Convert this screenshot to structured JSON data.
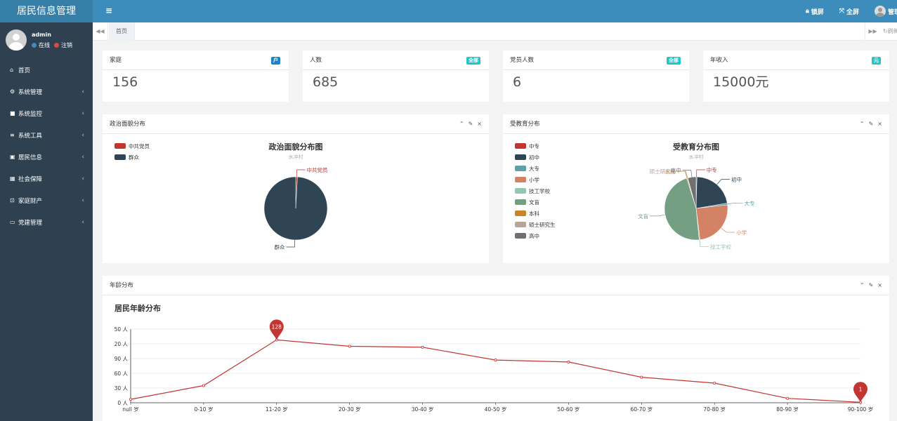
{
  "header": {
    "brand": "居民信息管理",
    "menu_toggle": "≡",
    "lock_label": "锁屏",
    "fullscreen_label": "全屏",
    "user_label": "管理员"
  },
  "sidebar": {
    "user_name": "admin",
    "online_label": "在线",
    "logout_label": "注销",
    "items": [
      {
        "label": "首页",
        "icon": "home-icon",
        "has_children": false
      },
      {
        "label": "系统管理",
        "icon": "gear-icon",
        "has_children": true
      },
      {
        "label": "系统监控",
        "icon": "video-icon",
        "has_children": true
      },
      {
        "label": "系统工具",
        "icon": "bars-icon",
        "has_children": true
      },
      {
        "label": "居民信息",
        "icon": "id-card-icon",
        "has_children": true
      },
      {
        "label": "社会保障",
        "icon": "table-icon",
        "has_children": true
      },
      {
        "label": "家庭财产",
        "icon": "box-icon",
        "has_children": true
      },
      {
        "label": "党建管理",
        "icon": "monitor-icon",
        "has_children": true
      }
    ]
  },
  "tabs": {
    "home": "首页",
    "refresh": "刷新"
  },
  "stats": [
    {
      "label": "家庭",
      "badge": "户",
      "badge_color": "#1c84c6",
      "value": "156"
    },
    {
      "label": "人数",
      "badge": "全部",
      "badge_color": "#23c6c8",
      "value": "685"
    },
    {
      "label": "党员人数",
      "badge": "全部",
      "badge_color": "#23c6c8",
      "value": "6"
    },
    {
      "label": "年收入",
      "badge": "元",
      "badge_color": "#23c6c8",
      "value": "15000元"
    }
  ],
  "panels": {
    "political": {
      "title": "政治面貌分布"
    },
    "education": {
      "title": "受教育分布"
    },
    "age": {
      "title": "年龄分布"
    },
    "tools": {
      "collapse": "⌃",
      "config": "🔧",
      "close": "×"
    }
  },
  "chart_data": [
    {
      "type": "pie",
      "title": "政治面貌分布图",
      "subtitle": "水冲村",
      "categories": [
        "中共党员",
        "群众"
      ],
      "values": [
        6,
        679
      ],
      "colors": [
        "#c23531",
        "#2f4554"
      ]
    },
    {
      "type": "pie",
      "title": "受教育分布图",
      "subtitle": "水冲村",
      "categories": [
        "中专",
        "初中",
        "大专",
        "小学",
        "技工学校",
        "文盲",
        "本科",
        "硕士研究生",
        "高中"
      ],
      "values": [
        3,
        150,
        6,
        170,
        3,
        320,
        3,
        1,
        29
      ],
      "colors": [
        "#c23531",
        "#2f4554",
        "#61a0a8",
        "#d48265",
        "#91c7ae",
        "#749f83",
        "#ca8622",
        "#bda29a",
        "#6e7074"
      ]
    },
    {
      "type": "line",
      "title": "居民年龄分布",
      "categories": [
        "null 岁",
        "0-10 岁",
        "11-20 岁",
        "20-30 岁",
        "30-40 岁",
        "40-50 岁",
        "50-60 岁",
        "60-70 岁",
        "70-80 岁",
        "80-90 岁",
        "90-100 岁"
      ],
      "values": [
        7,
        35,
        128,
        115,
        113,
        87,
        83,
        52,
        40,
        9,
        1
      ],
      "y_tick_labels": [
        "0 人",
        "30 人",
        "60 人",
        "90 人",
        "20 人",
        "50 人"
      ],
      "markers": [
        {
          "category": "11-20 岁",
          "label": "128"
        },
        {
          "category": "90-100 岁",
          "label": "1"
        }
      ],
      "color": "#c23531",
      "ylim": [
        0,
        150
      ],
      "grid": true
    }
  ]
}
